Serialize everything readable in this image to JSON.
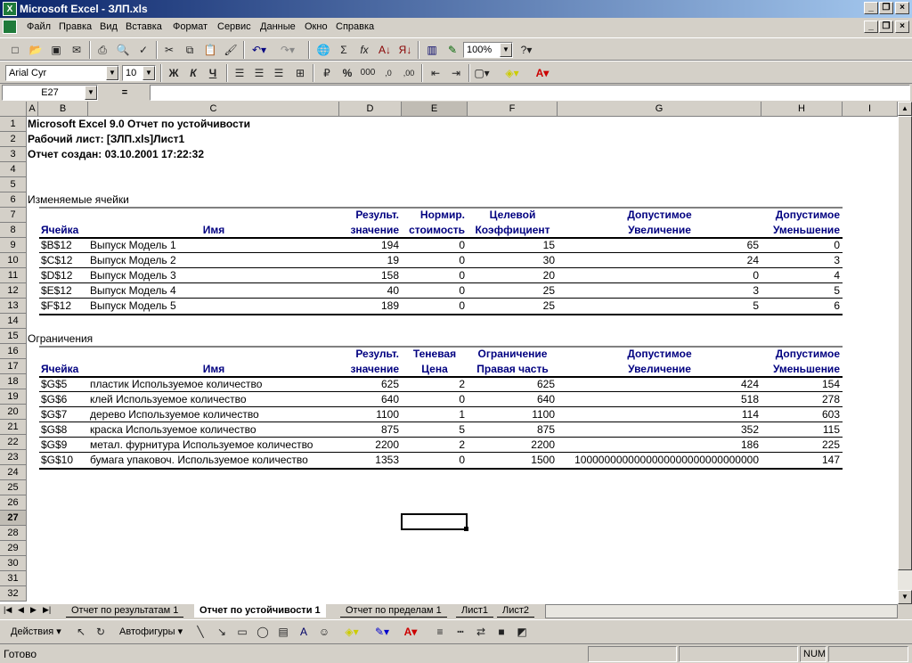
{
  "window": {
    "title": "Microsoft Excel - ЗЛП.xls",
    "icon_label": "X"
  },
  "menu": [
    "Файл",
    "Правка",
    "Вид",
    "Вставка",
    "Формат",
    "Сервис",
    "Данные",
    "Окно",
    "Справка"
  ],
  "toolbar": {
    "zoom": "100%",
    "font": "Arial Cyr",
    "font_size": "10",
    "bold": "Ж",
    "italic": "К",
    "underline": "Ч",
    "percent": "%",
    "thousands": "000",
    "inc_dec": ",0",
    "dec_dec": ",00"
  },
  "formula_bar": {
    "name_box": "E27",
    "equals": "=",
    "formula": ""
  },
  "columns": [
    "A",
    "B",
    "C",
    "D",
    "E",
    "F",
    "G",
    "H",
    "I"
  ],
  "rows": [
    "1",
    "2",
    "3",
    "4",
    "5",
    "6",
    "7",
    "8",
    "9",
    "10",
    "11",
    "12",
    "13",
    "14",
    "15",
    "16",
    "17",
    "18",
    "19",
    "20",
    "21",
    "22",
    "23",
    "24",
    "25",
    "26",
    "27",
    "28",
    "29",
    "30",
    "31",
    "32"
  ],
  "report": {
    "title": "Microsoft Excel 9.0 Отчет по устойчивости",
    "sheet": "Рабочий лист: [ЗЛП.xls]Лист1",
    "created": "Отчет создан: 03.10.2001 17:22:32",
    "section1": "Изменяемые ячейки",
    "h1": {
      "d_top": "Результ.",
      "d_bot": "значение",
      "e_top": "Нормир.",
      "e_bot": "стоимость",
      "f_top": "Целевой",
      "f_bot": "Коэффициент",
      "g_top": "Допустимое",
      "g_bot": "Увеличение",
      "h_top": "Допустимое",
      "h_bot": "Уменьшение",
      "b": "Ячейка",
      "c": "Имя"
    },
    "cells": [
      [
        "$B$12",
        "Выпуск Модель 1",
        "194",
        "0",
        "15",
        "65",
        "0"
      ],
      [
        "$C$12",
        "Выпуск Модель 2",
        "19",
        "0",
        "30",
        "24",
        "3"
      ],
      [
        "$D$12",
        "Выпуск Модель 3",
        "158",
        "0",
        "20",
        "0",
        "4"
      ],
      [
        "$E$12",
        "Выпуск Модель 4",
        "40",
        "0",
        "25",
        "3",
        "5"
      ],
      [
        "$F$12",
        "Выпуск Модель 5",
        "189",
        "0",
        "25",
        "5",
        "6"
      ]
    ],
    "section2": "Ограничения",
    "h2": {
      "d_top": "Результ.",
      "d_bot": "значение",
      "e_top": "Теневая",
      "e_bot": "Цена",
      "f_top": "Ограничение",
      "f_bot": "Правая часть",
      "g_top": "Допустимое",
      "g_bot": "Увеличение",
      "h_top": "Допустимое",
      "h_bot": "Уменьшение",
      "b": "Ячейка",
      "c": "Имя"
    },
    "constraints": [
      [
        "$G$5",
        "пластик Используемое количество",
        "625",
        "2",
        "625",
        "424",
        "154"
      ],
      [
        "$G$6",
        "клей Используемое количество",
        "640",
        "0",
        "640",
        "518",
        "278"
      ],
      [
        "$G$7",
        "дерево Используемое количество",
        "1100",
        "1",
        "1100",
        "114",
        "603"
      ],
      [
        "$G$8",
        "краска Используемое количество",
        "875",
        "5",
        "875",
        "352",
        "115"
      ],
      [
        "$G$9",
        "метал. фурнитура Используемое количество",
        "2200",
        "2",
        "2200",
        "186",
        "225"
      ],
      [
        "$G$10",
        "бумага упаковоч. Используемое количество",
        "1353",
        "0",
        "1500",
        "1000000000000000000000000000000",
        "147"
      ]
    ]
  },
  "tabs": [
    "Отчет по результатам 1",
    "Отчет по устойчивости 1",
    "Отчет по пределам 1",
    "Лист1",
    "Лист2"
  ],
  "drawing": {
    "actions": "Действия ▾",
    "autoshapes": "Автофигуры ▾"
  },
  "status": {
    "ready": "Готово",
    "num": "NUM"
  }
}
